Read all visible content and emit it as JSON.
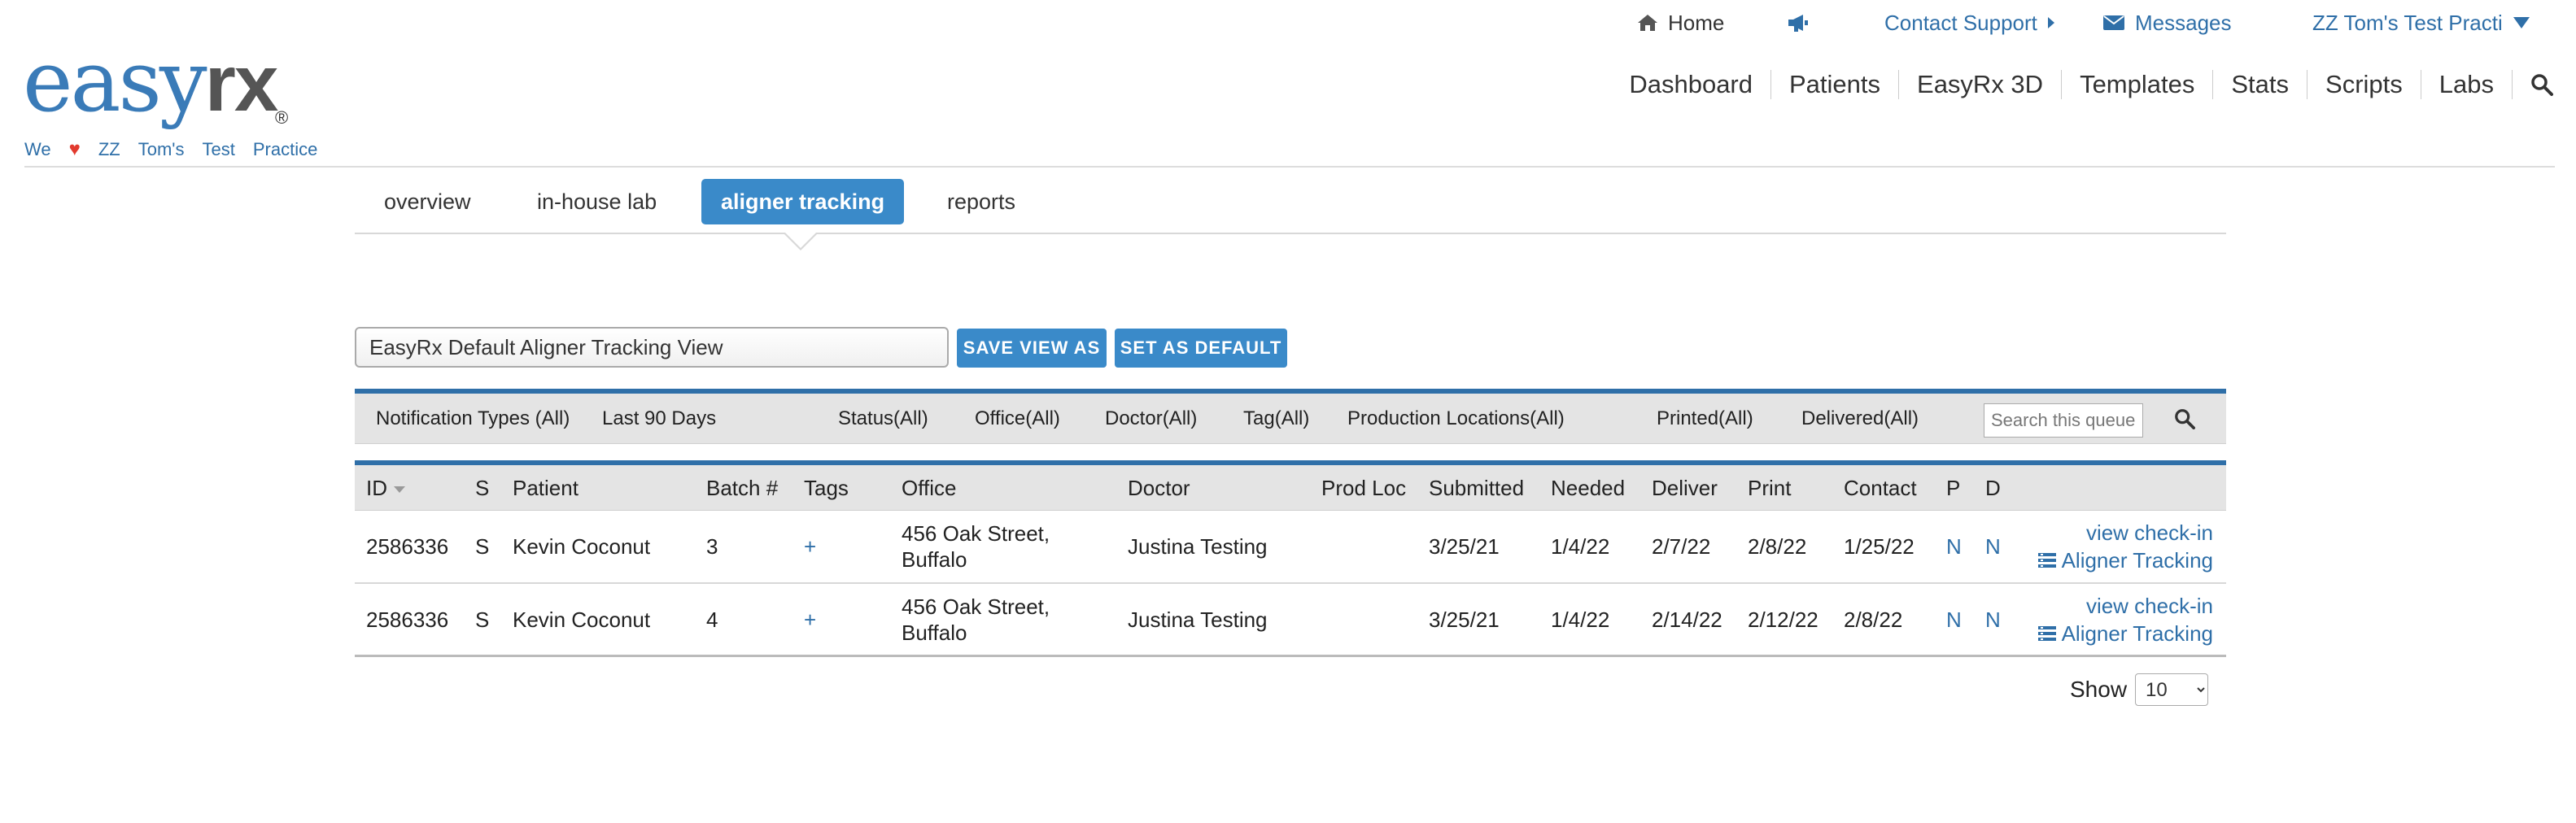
{
  "utility": {
    "home": "Home",
    "support": "Contact Support",
    "messages": "Messages",
    "account": "ZZ Tom's Test Practi"
  },
  "logo": {
    "easy": "easy",
    "rx": "rx",
    "reg": "®"
  },
  "tagline": [
    "We",
    "ZZ",
    "Tom's",
    "Test",
    "Practice"
  ],
  "nav": [
    "Dashboard",
    "Patients",
    "EasyRx 3D",
    "Templates",
    "Stats",
    "Scripts",
    "Labs"
  ],
  "subtabs": {
    "overview": "overview",
    "inhouse": "in-house lab",
    "aligner": "aligner tracking",
    "reports": "reports"
  },
  "view": {
    "current": "EasyRx Default Aligner Tracking View",
    "save_label": "SAVE VIEW AS",
    "default_label": "SET AS DEFAULT"
  },
  "filters": {
    "notification": "Notification Types (All)",
    "days": "Last 90 Days",
    "status": "Status(All)",
    "office": "Office(All)",
    "doctor": "Doctor(All)",
    "tag": "Tag(All)",
    "production": "Production Locations(All)",
    "printed": "Printed(All)",
    "delivered": "Delivered(All)",
    "search_placeholder": "Search this queue"
  },
  "table": {
    "headers": {
      "id": "ID",
      "s": "S",
      "patient": "Patient",
      "batch": "Batch #",
      "tags": "Tags",
      "office": "Office",
      "doctor": "Doctor",
      "prodloc": "Prod Loc",
      "submitted": "Submitted",
      "needed": "Needed",
      "deliver": "Deliver",
      "print": "Print",
      "contact": "Contact",
      "p": "P",
      "d": "D"
    },
    "rows": [
      {
        "id": "2586336",
        "s": "S",
        "patient": "Kevin Coconut",
        "batch": "3",
        "tags": "+",
        "office": "456 Oak Street, Buffalo",
        "doctor": "Justina Testing",
        "prodloc": "",
        "submitted": "3/25/21",
        "needed": "1/4/22",
        "deliver": "2/7/22",
        "print": "2/8/22",
        "contact": "1/25/22",
        "p": "N",
        "d": "N",
        "action1": "view check-in",
        "action2": "Aligner Tracking"
      },
      {
        "id": "2586336",
        "s": "S",
        "patient": "Kevin Coconut",
        "batch": "4",
        "tags": "+",
        "office": "456 Oak Street, Buffalo",
        "doctor": "Justina Testing",
        "prodloc": "",
        "submitted": "3/25/21",
        "needed": "1/4/22",
        "deliver": "2/14/22",
        "print": "2/12/22",
        "contact": "2/8/22",
        "p": "N",
        "d": "N",
        "action1": "view check-in",
        "action2": "Aligner Tracking"
      }
    ]
  },
  "pager": {
    "show_label": "Show",
    "page_size": "10"
  },
  "colors": {
    "brand_blue": "#3a8ac9",
    "link_blue": "#2f6fa8",
    "heart_red": "#e23a2e"
  }
}
